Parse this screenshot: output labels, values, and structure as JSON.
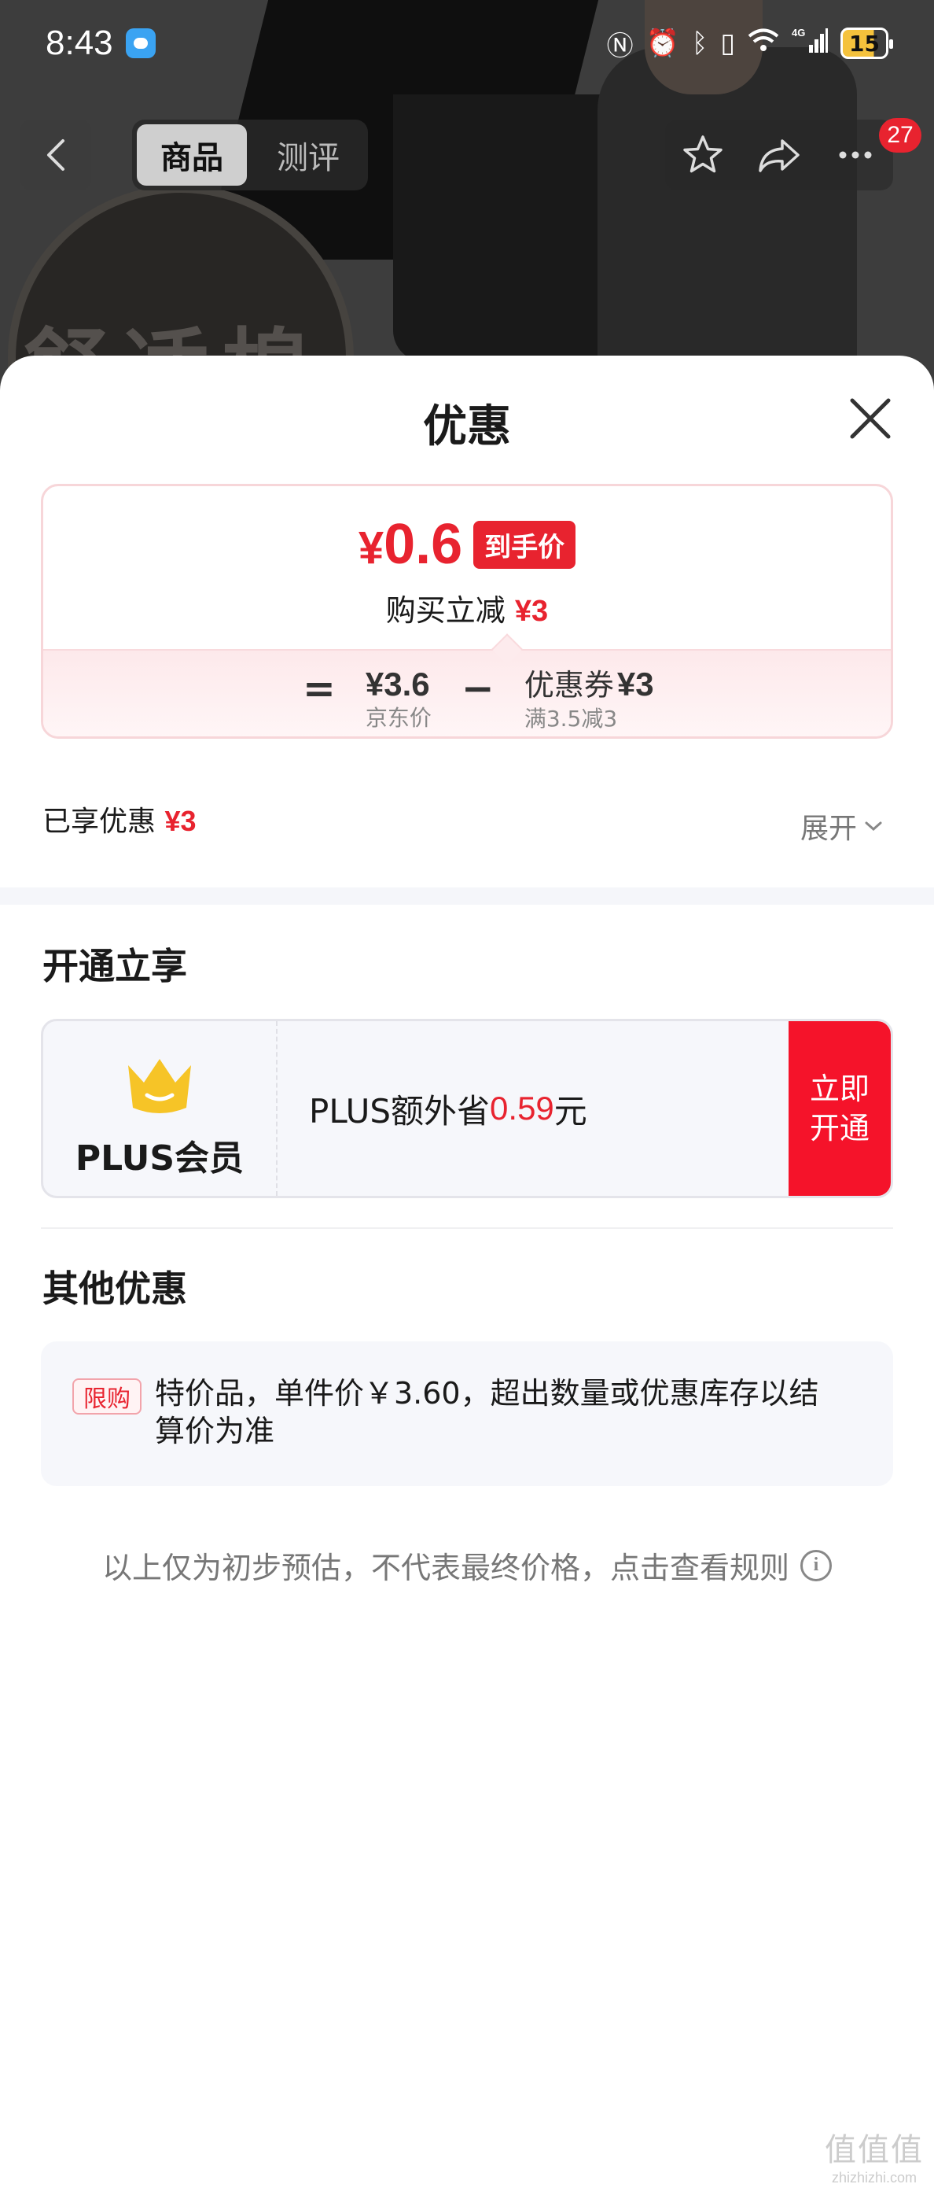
{
  "status_bar": {
    "time": "8:43",
    "battery": "15",
    "network": "4G"
  },
  "nav": {
    "tabs": [
      {
        "label": "商品",
        "active": true
      },
      {
        "label": "测评",
        "active": false
      }
    ],
    "badge_count": "27"
  },
  "background": {
    "badge_text": "舒适棉"
  },
  "sheet": {
    "title": "优惠",
    "price": {
      "currency": "¥",
      "final": "0.6",
      "final_tag": "到手价",
      "discount_label": "购买立减",
      "discount_value": "¥3",
      "formula": {
        "eq": "=",
        "base_value": "¥3.6",
        "base_desc": "京东价",
        "minus": "−",
        "coupon_label": "优惠券",
        "coupon_value": "¥3",
        "coupon_desc": "满3.5减3"
      }
    },
    "enjoyed": {
      "label": "已享优惠",
      "value": "¥3"
    },
    "expand_label": "展开",
    "member_section": {
      "title": "开通立享",
      "card_name": "PLUS会员",
      "desc_prefix": "PLUS额外省",
      "desc_value": "0.59",
      "desc_suffix": "元",
      "button_label": "立即开通"
    },
    "other_section": {
      "title": "其他优惠",
      "tag": "限购",
      "text": "特价品，单件价￥3.60，超出数量或优惠库存以结算价为准"
    },
    "disclaimer": "以上仅为初步预估，不代表最终价格，点击查看规则"
  },
  "watermark": {
    "logo": "值值值",
    "url": "zhizhizhi.com"
  },
  "colors": {
    "accent_red": "#e8232f",
    "button_red": "#f5132a",
    "crown_yellow": "#f6c427"
  },
  "icons": [
    "back-icon",
    "star-icon",
    "share-icon",
    "more-icon",
    "close-icon",
    "chevron-down-icon",
    "crown-icon",
    "info-icon"
  ]
}
